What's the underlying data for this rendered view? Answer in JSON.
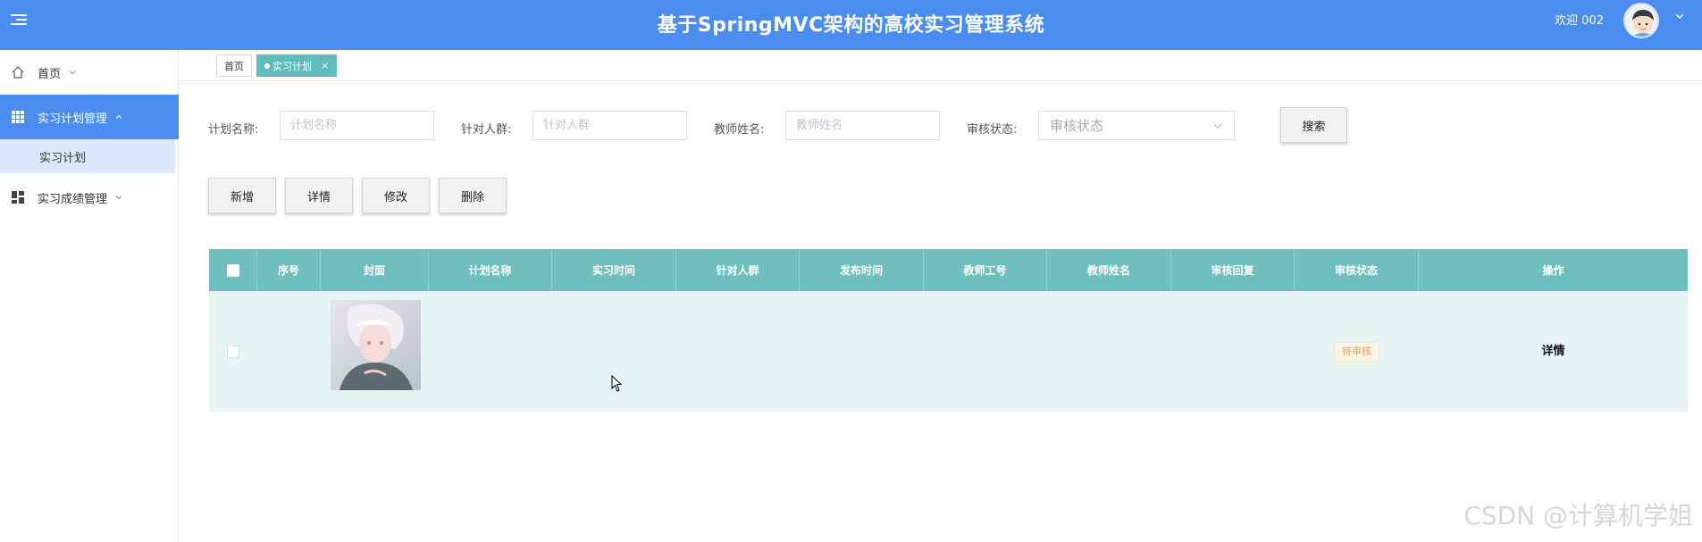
{
  "header": {
    "title": "基于SpringMVC架构的高校实习管理系统",
    "welcome": "欢迎 002",
    "bg_color": "#4a8cf0"
  },
  "sidebar": {
    "items": [
      {
        "label": "首页",
        "icon": "home-icon"
      },
      {
        "label": "实习计划管理",
        "icon": "grid-icon"
      },
      {
        "label": "实习计划",
        "icon": ""
      },
      {
        "label": "实习成绩管理",
        "icon": "dashboard-icon"
      }
    ]
  },
  "tabs": [
    {
      "label": "首页"
    },
    {
      "label": "实习计划",
      "close": "×"
    }
  ],
  "search": {
    "plan_name_label": "计划名称:",
    "plan_name_placeholder": "计划名称",
    "target_label": "针对人群:",
    "target_placeholder": "针对人群",
    "teacher_label": "教师姓名:",
    "teacher_placeholder": "教师姓名",
    "status_label": "审核状态:",
    "status_placeholder": "审核状态",
    "search_button": "搜索"
  },
  "actions": {
    "add": "新增",
    "detail": "详情",
    "edit": "修改",
    "delete": "删除"
  },
  "table": {
    "columns": [
      "序号",
      "封面",
      "计划名称",
      "实习时间",
      "针对人群",
      "发布时间",
      "教师工号",
      "教师姓名",
      "审核回复",
      "审核状态",
      "操作"
    ],
    "rows": [
      {
        "index": "1",
        "plan_name": "",
        "intern_time": "",
        "target": "",
        "publish_time": "",
        "teacher_no": "",
        "teacher_name": "",
        "review_reply": "",
        "status": "待审核",
        "action": "详情"
      }
    ]
  },
  "watermark": "CSDN @计算机学姐"
}
